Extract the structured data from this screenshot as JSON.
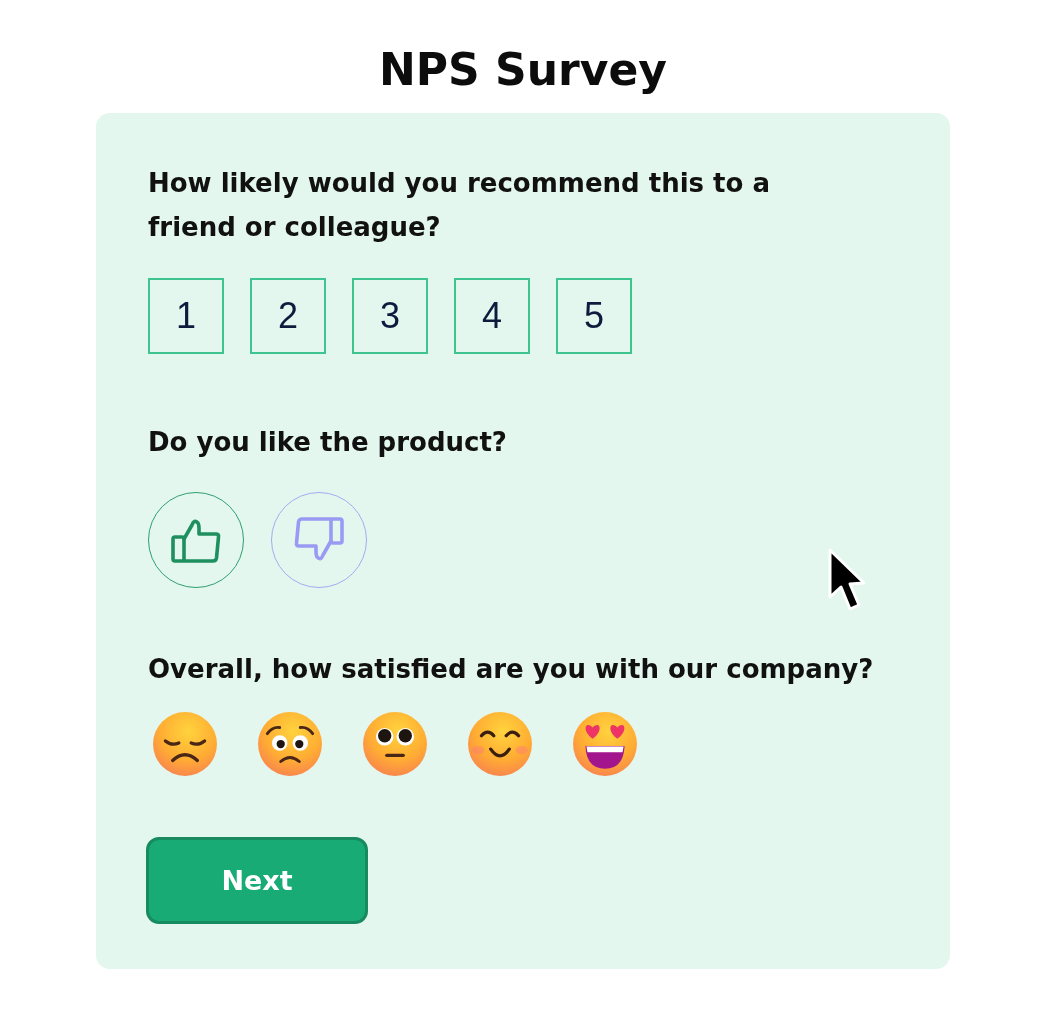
{
  "title": "NPS Survey",
  "recommend": {
    "question": "How likely would you recommend this to a friend or colleague?",
    "options": [
      {
        "label": "1",
        "selected": false
      },
      {
        "label": "2",
        "selected": false
      },
      {
        "label": "3",
        "selected": false
      },
      {
        "label": "4",
        "selected": false
      },
      {
        "label": "5",
        "selected": false
      }
    ]
  },
  "like": {
    "question": "Do you like the product?",
    "options": [
      {
        "kind": "thumbs_up",
        "selected": false
      },
      {
        "kind": "thumbs_down",
        "selected": false
      }
    ]
  },
  "satisfaction": {
    "question": "Overall, how satisfied are you with our company?",
    "options": [
      {
        "kind": "pensive",
        "selected": false
      },
      {
        "kind": "worried",
        "selected": false
      },
      {
        "kind": "neutral",
        "selected": false
      },
      {
        "kind": "smiling",
        "selected": false
      },
      {
        "kind": "heart_eyes",
        "selected": false
      }
    ]
  },
  "next_button": {
    "label": "Next"
  }
}
